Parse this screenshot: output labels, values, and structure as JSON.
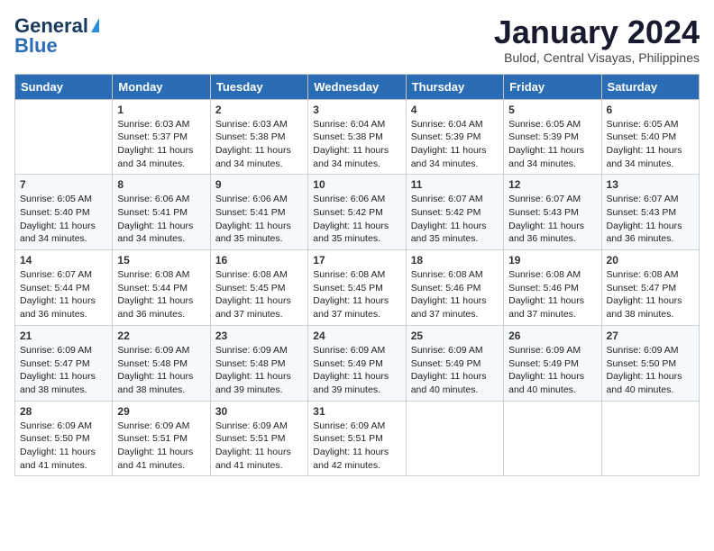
{
  "header": {
    "logo_general": "General",
    "logo_blue": "Blue",
    "month_title": "January 2024",
    "location": "Bulod, Central Visayas, Philippines"
  },
  "weekdays": [
    "Sunday",
    "Monday",
    "Tuesday",
    "Wednesday",
    "Thursday",
    "Friday",
    "Saturday"
  ],
  "weeks": [
    [
      {
        "day": "",
        "sunrise": "",
        "sunset": "",
        "daylight": ""
      },
      {
        "day": "1",
        "sunrise": "Sunrise: 6:03 AM",
        "sunset": "Sunset: 5:37 PM",
        "daylight": "Daylight: 11 hours and 34 minutes."
      },
      {
        "day": "2",
        "sunrise": "Sunrise: 6:03 AM",
        "sunset": "Sunset: 5:38 PM",
        "daylight": "Daylight: 11 hours and 34 minutes."
      },
      {
        "day": "3",
        "sunrise": "Sunrise: 6:04 AM",
        "sunset": "Sunset: 5:38 PM",
        "daylight": "Daylight: 11 hours and 34 minutes."
      },
      {
        "day": "4",
        "sunrise": "Sunrise: 6:04 AM",
        "sunset": "Sunset: 5:39 PM",
        "daylight": "Daylight: 11 hours and 34 minutes."
      },
      {
        "day": "5",
        "sunrise": "Sunrise: 6:05 AM",
        "sunset": "Sunset: 5:39 PM",
        "daylight": "Daylight: 11 hours and 34 minutes."
      },
      {
        "day": "6",
        "sunrise": "Sunrise: 6:05 AM",
        "sunset": "Sunset: 5:40 PM",
        "daylight": "Daylight: 11 hours and 34 minutes."
      }
    ],
    [
      {
        "day": "7",
        "sunrise": "Sunrise: 6:05 AM",
        "sunset": "Sunset: 5:40 PM",
        "daylight": "Daylight: 11 hours and 34 minutes."
      },
      {
        "day": "8",
        "sunrise": "Sunrise: 6:06 AM",
        "sunset": "Sunset: 5:41 PM",
        "daylight": "Daylight: 11 hours and 34 minutes."
      },
      {
        "day": "9",
        "sunrise": "Sunrise: 6:06 AM",
        "sunset": "Sunset: 5:41 PM",
        "daylight": "Daylight: 11 hours and 35 minutes."
      },
      {
        "day": "10",
        "sunrise": "Sunrise: 6:06 AM",
        "sunset": "Sunset: 5:42 PM",
        "daylight": "Daylight: 11 hours and 35 minutes."
      },
      {
        "day": "11",
        "sunrise": "Sunrise: 6:07 AM",
        "sunset": "Sunset: 5:42 PM",
        "daylight": "Daylight: 11 hours and 35 minutes."
      },
      {
        "day": "12",
        "sunrise": "Sunrise: 6:07 AM",
        "sunset": "Sunset: 5:43 PM",
        "daylight": "Daylight: 11 hours and 36 minutes."
      },
      {
        "day": "13",
        "sunrise": "Sunrise: 6:07 AM",
        "sunset": "Sunset: 5:43 PM",
        "daylight": "Daylight: 11 hours and 36 minutes."
      }
    ],
    [
      {
        "day": "14",
        "sunrise": "Sunrise: 6:07 AM",
        "sunset": "Sunset: 5:44 PM",
        "daylight": "Daylight: 11 hours and 36 minutes."
      },
      {
        "day": "15",
        "sunrise": "Sunrise: 6:08 AM",
        "sunset": "Sunset: 5:44 PM",
        "daylight": "Daylight: 11 hours and 36 minutes."
      },
      {
        "day": "16",
        "sunrise": "Sunrise: 6:08 AM",
        "sunset": "Sunset: 5:45 PM",
        "daylight": "Daylight: 11 hours and 37 minutes."
      },
      {
        "day": "17",
        "sunrise": "Sunrise: 6:08 AM",
        "sunset": "Sunset: 5:45 PM",
        "daylight": "Daylight: 11 hours and 37 minutes."
      },
      {
        "day": "18",
        "sunrise": "Sunrise: 6:08 AM",
        "sunset": "Sunset: 5:46 PM",
        "daylight": "Daylight: 11 hours and 37 minutes."
      },
      {
        "day": "19",
        "sunrise": "Sunrise: 6:08 AM",
        "sunset": "Sunset: 5:46 PM",
        "daylight": "Daylight: 11 hours and 37 minutes."
      },
      {
        "day": "20",
        "sunrise": "Sunrise: 6:08 AM",
        "sunset": "Sunset: 5:47 PM",
        "daylight": "Daylight: 11 hours and 38 minutes."
      }
    ],
    [
      {
        "day": "21",
        "sunrise": "Sunrise: 6:09 AM",
        "sunset": "Sunset: 5:47 PM",
        "daylight": "Daylight: 11 hours and 38 minutes."
      },
      {
        "day": "22",
        "sunrise": "Sunrise: 6:09 AM",
        "sunset": "Sunset: 5:48 PM",
        "daylight": "Daylight: 11 hours and 38 minutes."
      },
      {
        "day": "23",
        "sunrise": "Sunrise: 6:09 AM",
        "sunset": "Sunset: 5:48 PM",
        "daylight": "Daylight: 11 hours and 39 minutes."
      },
      {
        "day": "24",
        "sunrise": "Sunrise: 6:09 AM",
        "sunset": "Sunset: 5:49 PM",
        "daylight": "Daylight: 11 hours and 39 minutes."
      },
      {
        "day": "25",
        "sunrise": "Sunrise: 6:09 AM",
        "sunset": "Sunset: 5:49 PM",
        "daylight": "Daylight: 11 hours and 40 minutes."
      },
      {
        "day": "26",
        "sunrise": "Sunrise: 6:09 AM",
        "sunset": "Sunset: 5:49 PM",
        "daylight": "Daylight: 11 hours and 40 minutes."
      },
      {
        "day": "27",
        "sunrise": "Sunrise: 6:09 AM",
        "sunset": "Sunset: 5:50 PM",
        "daylight": "Daylight: 11 hours and 40 minutes."
      }
    ],
    [
      {
        "day": "28",
        "sunrise": "Sunrise: 6:09 AM",
        "sunset": "Sunset: 5:50 PM",
        "daylight": "Daylight: 11 hours and 41 minutes."
      },
      {
        "day": "29",
        "sunrise": "Sunrise: 6:09 AM",
        "sunset": "Sunset: 5:51 PM",
        "daylight": "Daylight: 11 hours and 41 minutes."
      },
      {
        "day": "30",
        "sunrise": "Sunrise: 6:09 AM",
        "sunset": "Sunset: 5:51 PM",
        "daylight": "Daylight: 11 hours and 41 minutes."
      },
      {
        "day": "31",
        "sunrise": "Sunrise: 6:09 AM",
        "sunset": "Sunset: 5:51 PM",
        "daylight": "Daylight: 11 hours and 42 minutes."
      },
      {
        "day": "",
        "sunrise": "",
        "sunset": "",
        "daylight": ""
      },
      {
        "day": "",
        "sunrise": "",
        "sunset": "",
        "daylight": ""
      },
      {
        "day": "",
        "sunrise": "",
        "sunset": "",
        "daylight": ""
      }
    ]
  ]
}
